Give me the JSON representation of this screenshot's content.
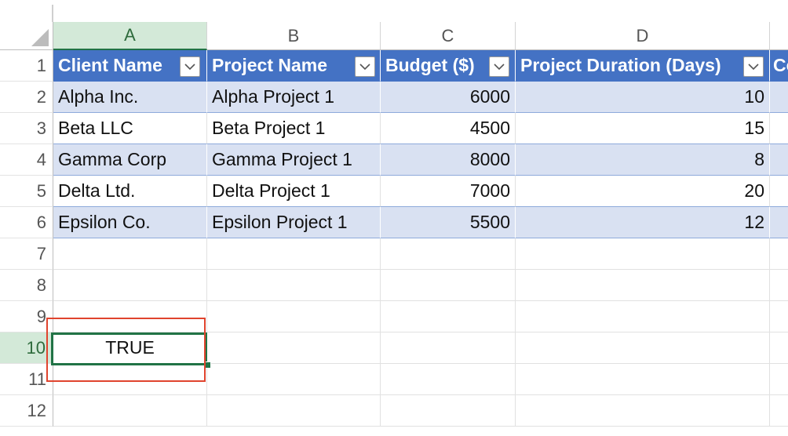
{
  "columns": [
    "A",
    "B",
    "C",
    "D"
  ],
  "rows": [
    "1",
    "2",
    "3",
    "4",
    "5",
    "6",
    "7",
    "8",
    "9",
    "10",
    "11",
    "12"
  ],
  "table": {
    "headers": [
      "Client Name",
      "Project Name",
      "Budget ($)",
      "Project Duration (Days)",
      "Co"
    ],
    "data": [
      [
        "Alpha Inc.",
        "Alpha Project 1",
        "6000",
        "10"
      ],
      [
        "Beta LLC",
        "Beta Project 1",
        "4500",
        "15"
      ],
      [
        "Gamma Corp",
        "Gamma Project 1",
        "8000",
        "8"
      ],
      [
        "Delta Ltd.",
        "Delta Project 1",
        "7000",
        "20"
      ],
      [
        "Epsilon Co.",
        "Epsilon Project 1",
        "5500",
        "12"
      ]
    ]
  },
  "selected_cell": {
    "address": "A10",
    "value": "TRUE"
  },
  "colors": {
    "table_header": "#4472c4",
    "banded_row": "#d9e1f2",
    "selection": "#217346",
    "highlight": "#e0442e"
  },
  "icons": {
    "filter": "chevron-down-icon",
    "select_all": "select-all-triangle-icon"
  }
}
